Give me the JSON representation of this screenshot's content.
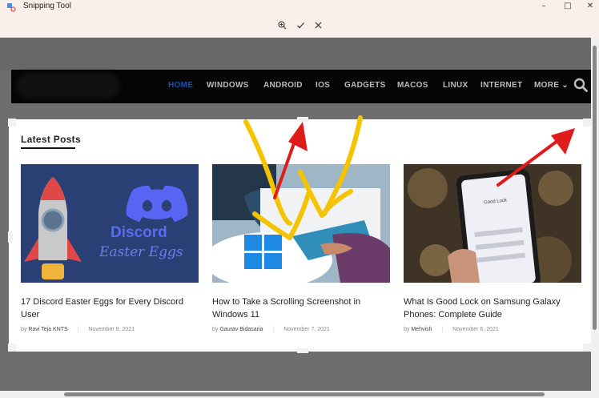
{
  "app": {
    "title": "Snipping Tool",
    "window_buttons": {
      "minimize": "–",
      "maximize": "□",
      "close": "✕"
    },
    "toolbar": {
      "zoom_icon": "zoom-in-icon",
      "confirm_icon": "checkmark-icon",
      "discard_icon": "close-icon"
    }
  },
  "site": {
    "nav": [
      "HOME",
      "WINDOWS",
      "ANDROID",
      "IOS",
      "GADGETS",
      "MACOS",
      "LINUX",
      "INTERNET",
      "MORE ⌄"
    ],
    "active_color": "#1f4fa8"
  },
  "section": {
    "title": "Latest Posts"
  },
  "posts": [
    {
      "title": "17 Discord Easter Eggs for Every Discord User",
      "by": "by",
      "author": "Ravi Teja KNTS",
      "date": "November 8, 2021",
      "thumb_text_1": "Discord",
      "thumb_text_2": "Easter Eggs"
    },
    {
      "title": "How to Take a Scrolling Screenshot in Windows 11",
      "by": "by",
      "author": "Gaurav Bidasaria",
      "date": "November 7, 2021"
    },
    {
      "title": "What Is Good Lock on Samsung Galaxy Phones: Complete Guide",
      "by": "by",
      "author": "Mehvish",
      "date": "November 6, 2021",
      "thumb_text_1": "Good Lock"
    }
  ],
  "colors": {
    "annotation_yellow": "#f5c400",
    "annotation_red": "#e01b1b"
  }
}
